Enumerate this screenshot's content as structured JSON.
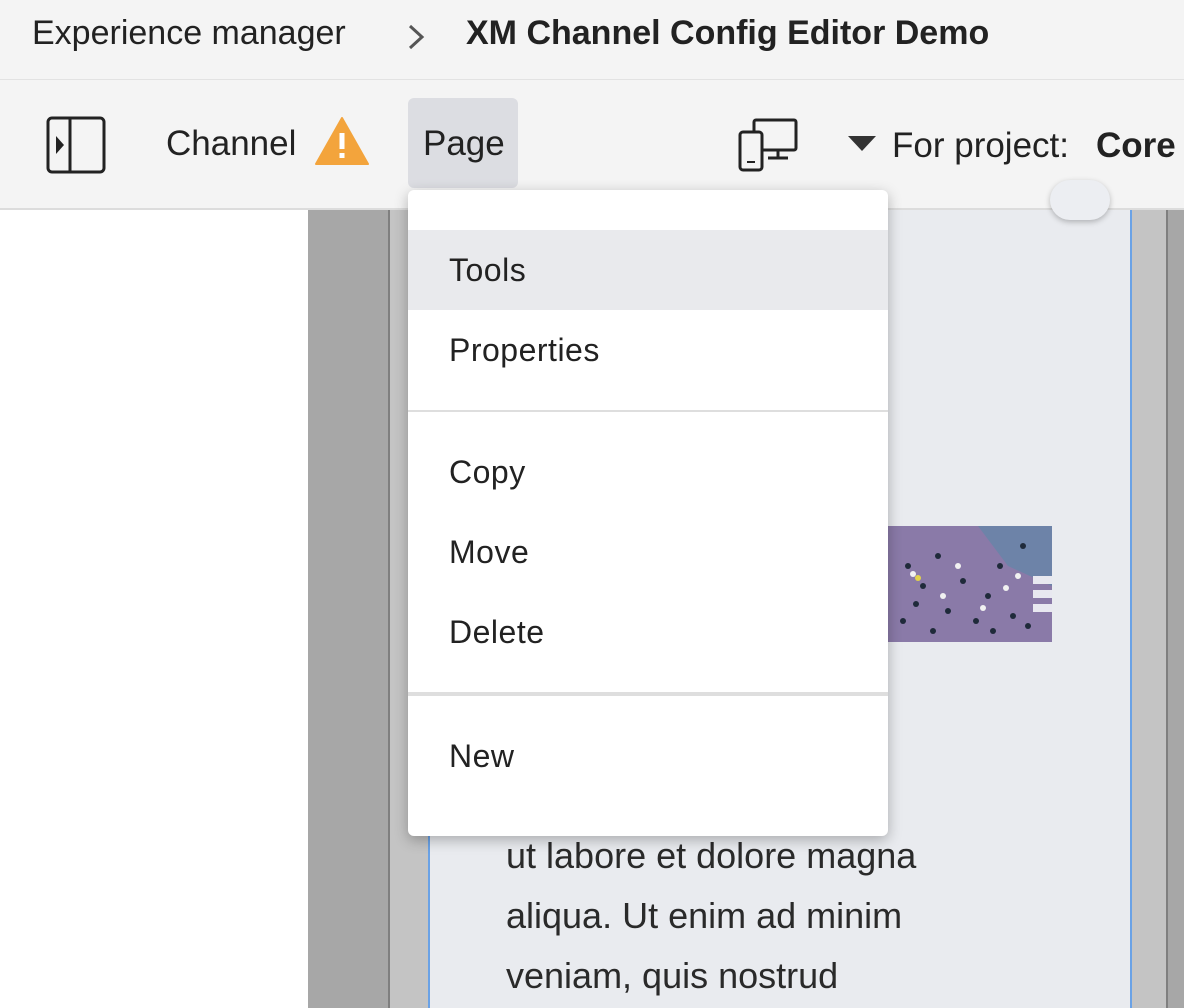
{
  "breadcrumb": {
    "root": "Experience manager",
    "current": "XM Channel Config Editor Demo"
  },
  "toolbar": {
    "channel_label": "Channel",
    "page_label": "Page",
    "project_label": "For project:",
    "project_value": "Core"
  },
  "page_menu": {
    "items": [
      "Tools",
      "Properties",
      "Copy",
      "Move",
      "Delete",
      "New"
    ],
    "active": "Tools"
  },
  "content": {
    "text_fragment": "amet,\ng elit, sed\ncididunt\nut labore et dolore magna\naliqua. Ut enim ad minim\nveniam, quis nostrud"
  },
  "colors": {
    "warning": "#f3a43c",
    "selection_border": "#6aa2e6",
    "toolbar_bg": "#f4f4f4"
  },
  "icons": {
    "sidebar_toggle": "sidebar-toggle-icon",
    "warning": "warning-icon",
    "devices": "devices-icon",
    "caret": "caret-down-icon",
    "separator": "chevron-right-icon"
  }
}
